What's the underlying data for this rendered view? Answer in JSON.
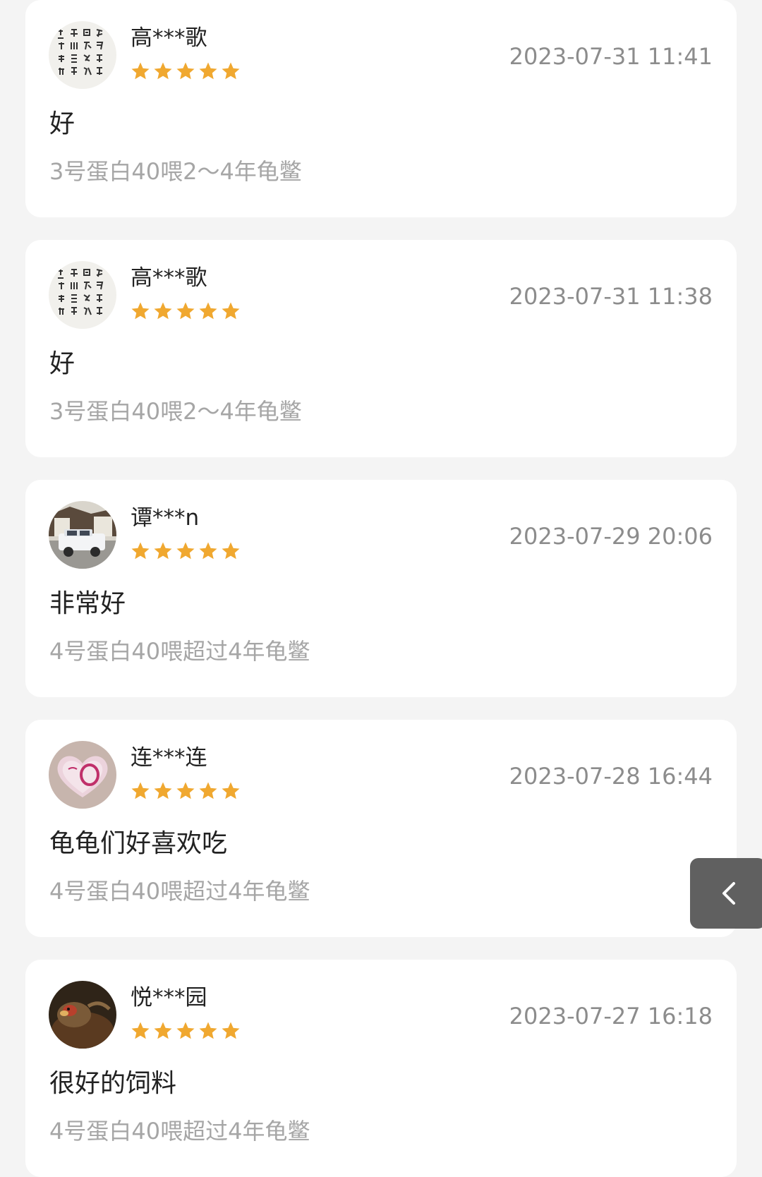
{
  "reviews": [
    {
      "username": "高***歌",
      "rating": 5,
      "timestamp": "2023-07-31 11:41",
      "comment": "好",
      "variant": "3号蛋白40喂2～4年龟鳖"
    },
    {
      "username": "高***歌",
      "rating": 5,
      "timestamp": "2023-07-31 11:38",
      "comment": "好",
      "variant": "3号蛋白40喂2～4年龟鳖"
    },
    {
      "username": "谭***n",
      "rating": 5,
      "timestamp": "2023-07-29 20:06",
      "comment": "非常好",
      "variant": "4号蛋白40喂超过4年龟鳖"
    },
    {
      "username": "连***连",
      "rating": 5,
      "timestamp": "2023-07-28 16:44",
      "comment": "龟龟们好喜欢吃",
      "variant": "4号蛋白40喂超过4年龟鳖"
    },
    {
      "username": "悦***园",
      "rating": 5,
      "timestamp": "2023-07-27 16:18",
      "comment": "很好的饲料",
      "variant": "4号蛋白40喂超过4年龟鳖"
    }
  ],
  "colors": {
    "star": "#f0a830",
    "background": "#f4f4f4",
    "card": "#ffffff"
  },
  "side_button": {
    "icon": "chevron-left-icon"
  }
}
